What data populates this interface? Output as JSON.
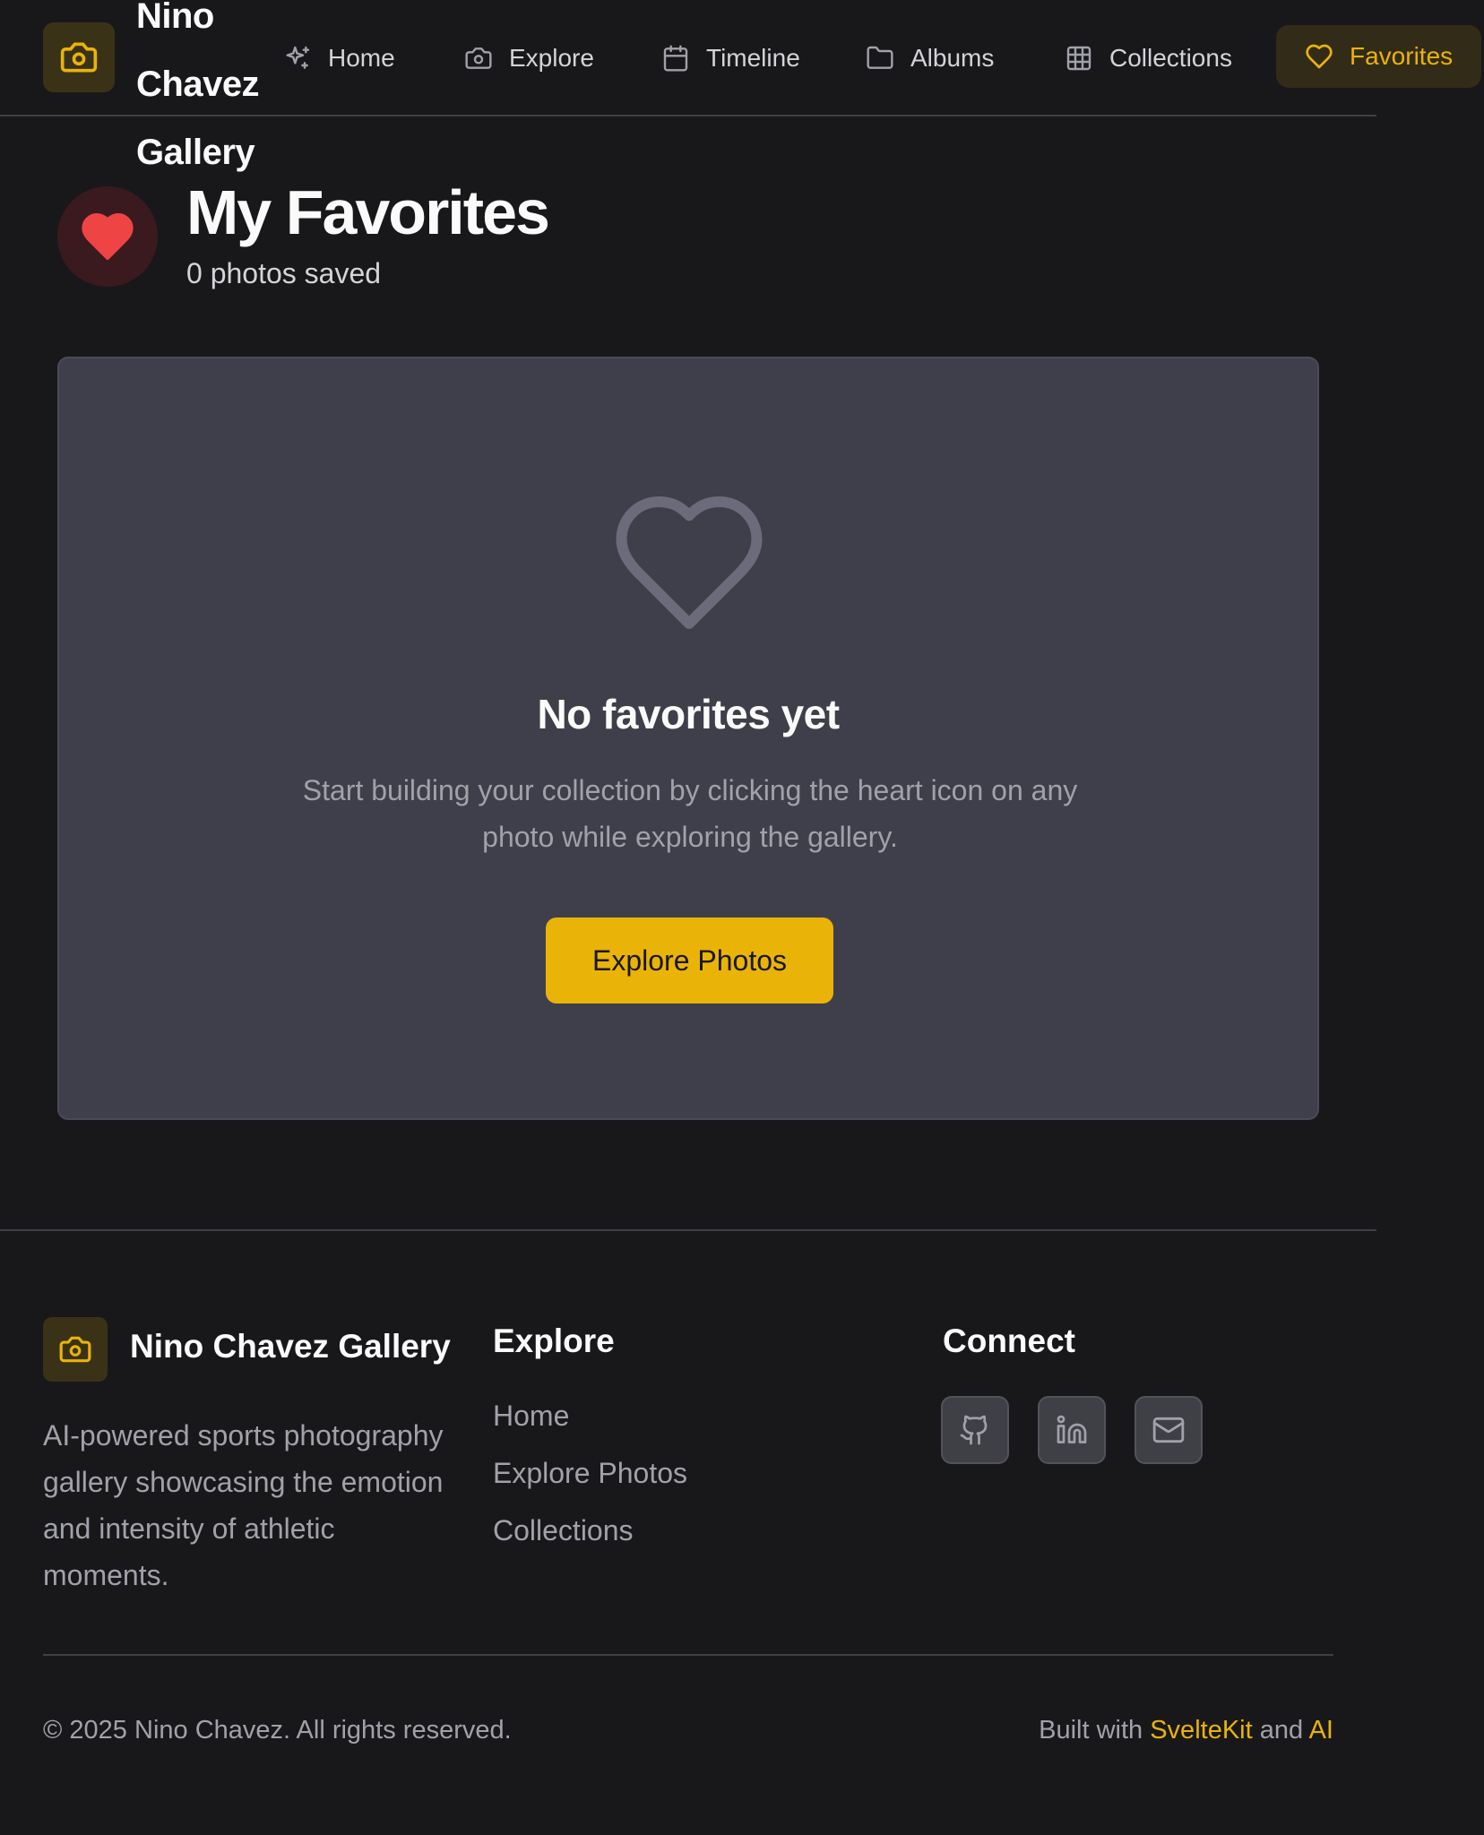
{
  "brand": {
    "name": "Nino Chavez Gallery",
    "icon": "camera-icon"
  },
  "nav": [
    {
      "label": "Home",
      "icon": "sparkles-icon"
    },
    {
      "label": "Explore",
      "icon": "camera-icon"
    },
    {
      "label": "Timeline",
      "icon": "calendar-icon"
    },
    {
      "label": "Albums",
      "icon": "folder-icon"
    },
    {
      "label": "Collections",
      "icon": "grid-icon"
    },
    {
      "label": "Favorites",
      "icon": "heart-icon",
      "active": true
    }
  ],
  "page": {
    "title": "My Favorites",
    "subtitle": "0 photos saved"
  },
  "empty_state": {
    "title": "No favorites yet",
    "description": "Start building your collection by clicking the heart icon on any photo while exploring the gallery.",
    "button_label": "Explore Photos"
  },
  "footer": {
    "brand_name": "Nino Chavez Gallery",
    "description": "AI-powered sports photography gallery showcasing the emotion and intensity of athletic moments.",
    "explore_heading": "Explore",
    "explore_links": [
      "Home",
      "Explore Photos",
      "Collections"
    ],
    "connect_heading": "Connect",
    "social": [
      "github-icon",
      "linkedin-icon",
      "mail-icon"
    ],
    "copyright": "© 2025 Nino Chavez. All rights reserved.",
    "built_prefix": "Built with",
    "built_tech": "SvelteKit",
    "built_and": "and",
    "built_ai": "AI"
  },
  "colors": {
    "background": "#18181b",
    "accent": "#eab308",
    "card": "#3f3f4b",
    "heart": "#ef4444",
    "muted_text": "#a1a1aa"
  }
}
